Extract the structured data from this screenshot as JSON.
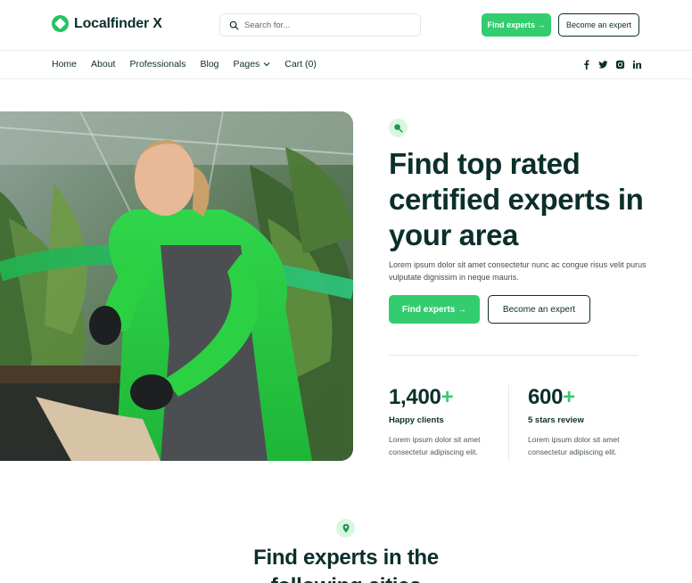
{
  "brand": {
    "name": "Localfinder X",
    "accent": "#33cc6f",
    "dark": "#0b2f2b"
  },
  "search": {
    "placeholder": "Search for..."
  },
  "header": {
    "find_label": "Find experts →",
    "become_label": "Become an expert"
  },
  "nav": {
    "items": [
      {
        "label": "Home"
      },
      {
        "label": "About"
      },
      {
        "label": "Professionals"
      },
      {
        "label": "Blog"
      },
      {
        "label": "Pages"
      },
      {
        "label": "Cart (0)"
      }
    ],
    "social": [
      "facebook-icon",
      "twitter-icon",
      "instagram-icon",
      "linkedin-icon"
    ]
  },
  "hero": {
    "title": "Find top rated certified experts in your area",
    "subtitle": "Lorem ipsum dolor sit amet consectetur nunc ac congue risus velit purus vulputate dignissim in neque mauris.",
    "find_label": "Find experts →",
    "become_label": "Become an expert",
    "stats": [
      {
        "number": "1,400",
        "plus": "+",
        "label": "Happy clients",
        "desc": "Lorem ipsum dolor sit amet consectetur adipiscing elit."
      },
      {
        "number": "600",
        "plus": "+",
        "label": "5 stars review",
        "desc": "Lorem ipsum dolor sit amet consectetur adipiscing elit."
      }
    ]
  },
  "cities": {
    "title": "Find experts in the following cities"
  }
}
